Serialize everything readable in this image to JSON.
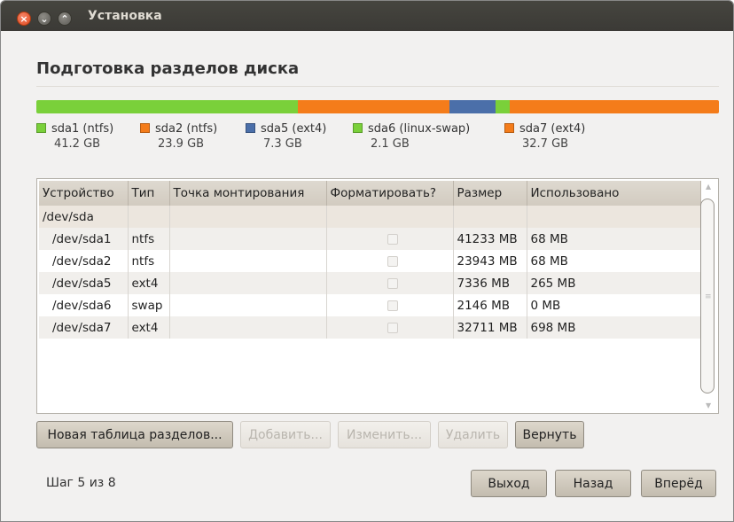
{
  "window": {
    "title": "Установка"
  },
  "page": {
    "heading": "Подготовка разделов диска"
  },
  "partition_bar": [
    {
      "name": "sda1 (ntfs)",
      "size": "41.2 GB",
      "fraction": 0.383,
      "color": "#7ad03a"
    },
    {
      "name": "sda2 (ntfs)",
      "size": "23.9 GB",
      "fraction": 0.222,
      "color": "#f47c1a"
    },
    {
      "name": "sda5 (ext4)",
      "size": "7.3 GB",
      "fraction": 0.068,
      "color": "#4b6fa9"
    },
    {
      "name": "sda6 (linux-swap)",
      "size": "2.1 GB",
      "fraction": 0.02,
      "color": "#7ad03a"
    },
    {
      "name": "sda7 (ext4)",
      "size": "32.7 GB",
      "fraction": 0.307,
      "color": "#f47c1a"
    }
  ],
  "table": {
    "columns": [
      "Устройство",
      "Тип",
      "Точка монтирования",
      "Форматировать?",
      "Размер",
      "Использовано"
    ],
    "group": "/dev/sda",
    "rows": [
      {
        "device": "/dev/sda1",
        "type": "ntfs",
        "mount": "",
        "size": "41233 MB",
        "used": "68 MB"
      },
      {
        "device": "/dev/sda2",
        "type": "ntfs",
        "mount": "",
        "size": "23943 MB",
        "used": "68 MB"
      },
      {
        "device": "/dev/sda5",
        "type": "ext4",
        "mount": "",
        "size": "7336 MB",
        "used": "265 MB"
      },
      {
        "device": "/dev/sda6",
        "type": "swap",
        "mount": "",
        "size": "2146 MB",
        "used": "0 MB"
      },
      {
        "device": "/dev/sda7",
        "type": "ext4",
        "mount": "",
        "size": "32711 MB",
        "used": "698 MB"
      }
    ]
  },
  "actions": {
    "new_table": "Новая таблица разделов...",
    "add": "Добавить...",
    "change": "Изменить...",
    "delete": "Удалить",
    "revert": "Вернуть"
  },
  "footer": {
    "step": "Шаг 5 из 8",
    "quit": "Выход",
    "back": "Назад",
    "forward": "Вперёд"
  },
  "icons": [
    "close-icon",
    "minimize-icon",
    "maximize-icon"
  ]
}
